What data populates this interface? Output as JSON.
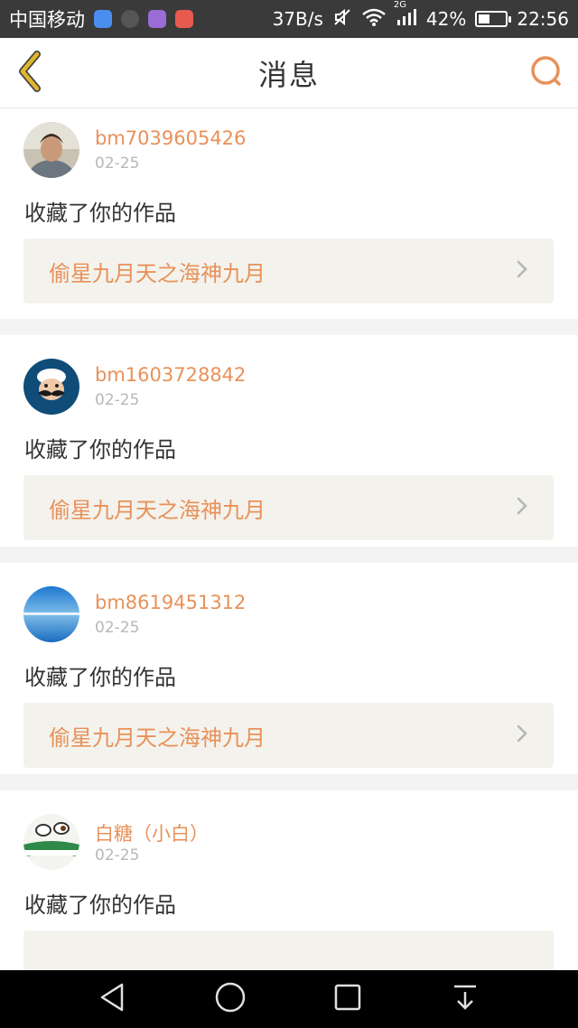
{
  "status_bar": {
    "carrier": "中国移动",
    "net_speed": "37B/s",
    "network": "2G",
    "battery": "42%",
    "battery_level": 0.42,
    "time": "22:56",
    "app_icon_colors": [
      "#4a8ef0",
      "#555555",
      "#9b6bd6",
      "#e85a4f"
    ]
  },
  "header": {
    "title": "消息"
  },
  "colors": {
    "accent": "#e8915a",
    "back_icon": "#e0b62d",
    "card_box_bg": "#f4f2ec"
  },
  "messages": [
    {
      "user": "bm7039605426",
      "date": "02-25",
      "action": "收藏了你的作品",
      "work_title": "偷星九月天之海神九月",
      "avatar": "person-photo"
    },
    {
      "user": "bm1603728842",
      "date": "02-25",
      "action": "收藏了你的作品",
      "work_title": "偷星九月天之海神九月",
      "avatar": "chef-cartoon"
    },
    {
      "user": "bm8619451312",
      "date": "02-25",
      "action": "收藏了你的作品",
      "work_title": "偷星九月天之海神九月",
      "avatar": "sky-landscape"
    },
    {
      "user": "白糖（小白）",
      "date": "02-25",
      "action": "收藏了你的作品",
      "work_title": "",
      "avatar": "cartoon-face"
    }
  ],
  "nav_bar": {
    "buttons": [
      "back-triangle-icon",
      "home-circle-icon",
      "recents-square-icon",
      "notification-down-icon"
    ]
  }
}
